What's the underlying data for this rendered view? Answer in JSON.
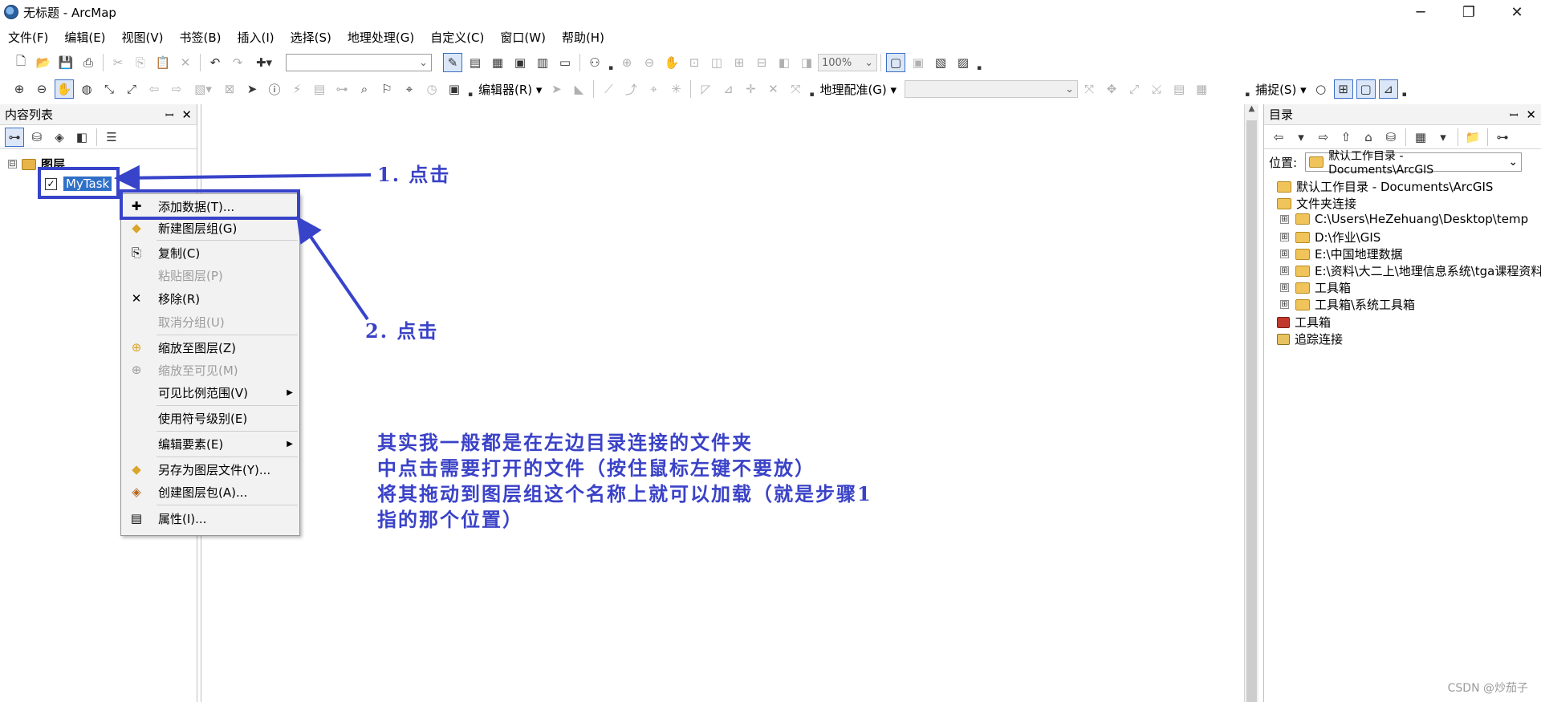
{
  "window": {
    "title": "无标题 - ArcMap",
    "minimize": "─",
    "maximize": "❐",
    "close": "✕"
  },
  "menubar": [
    "文件(F)",
    "编辑(E)",
    "视图(V)",
    "书签(B)",
    "插入(I)",
    "选择(S)",
    "地理处理(G)",
    "自定义(C)",
    "窗口(W)",
    "帮助(H)"
  ],
  "toolbar1": {
    "scale_combo": "",
    "zoom_combo": "100%"
  },
  "toolbar2": {
    "editor_label": "编辑器(R) ▾",
    "georef_label": "地理配准(G) ▾",
    "georef_combo": "",
    "snapping_label": "捕捉(S) ▾"
  },
  "toc": {
    "title": "内容列表",
    "pin": "ꟷ",
    "close": "✕",
    "root_expander": "⊟",
    "root_label": "图层",
    "layer_check": "✓",
    "layer_name": "MyTask"
  },
  "context_menu": {
    "items": [
      {
        "label": "添加数据(T)...",
        "icon": "✚",
        "disabled": false
      },
      {
        "label": "新建图层组(G)",
        "icon": "◆",
        "disabled": false
      },
      {
        "label": "复制(C)",
        "icon": "⎘",
        "disabled": false
      },
      {
        "label": "粘贴图层(P)",
        "icon": "",
        "disabled": true
      },
      {
        "label": "移除(R)",
        "icon": "✕",
        "disabled": false
      },
      {
        "label": "取消分组(U)",
        "icon": "",
        "disabled": true
      },
      {
        "label": "缩放至图层(Z)",
        "icon": "⊕",
        "disabled": false
      },
      {
        "label": "缩放至可见(M)",
        "icon": "⊕",
        "disabled": true
      },
      {
        "label": "可见比例范围(V)",
        "icon": "",
        "disabled": false,
        "submenu": "▶"
      },
      {
        "label": "使用符号级别(E)",
        "icon": "",
        "disabled": false
      },
      {
        "label": "编辑要素(E)",
        "icon": "",
        "disabled": false,
        "submenu": "▶"
      },
      {
        "label": "另存为图层文件(Y)...",
        "icon": "◆",
        "disabled": false
      },
      {
        "label": "创建图层包(A)...",
        "icon": "◈",
        "disabled": false
      },
      {
        "label": "属性(I)...",
        "icon": "▤",
        "disabled": false
      }
    ]
  },
  "catalog": {
    "title": "目录",
    "pin": "ꟷ",
    "close": "✕",
    "location_label": "位置:",
    "location_value": "默认工作目录 - Documents\\ArcGIS",
    "tree": [
      {
        "label": "默认工作目录 - Documents\\ArcGIS"
      },
      {
        "label": "文件夹连接"
      },
      {
        "label": "C:\\Users\\HeZehuang\\Desktop\\temp",
        "expander": "⊞"
      },
      {
        "label": "D:\\作业\\GIS",
        "expander": "⊞"
      },
      {
        "label": "E:\\中国地理数据",
        "expander": "⊞"
      },
      {
        "label": "E:\\资料\\大二上\\地理信息系统\\tga课程资料",
        "expander": "⊞"
      },
      {
        "label": "工具箱",
        "expander": "⊞"
      },
      {
        "label": "工具箱\\系统工具箱",
        "expander": "⊞"
      },
      {
        "label": "工具箱"
      },
      {
        "label": "追踪连接"
      }
    ]
  },
  "annotations": {
    "step1": "1. 点击",
    "step2": "2. 点击",
    "paragraph": [
      "其实我一般都是在左边目录连接的文件夹",
      "中点击需要打开的文件（按住鼠标左键不要放）",
      "将其拖动到图层组这个名称上就可以加载（就是步骤1",
      "指的那个位置）"
    ],
    "color": "#3743c9"
  },
  "watermark": "CSDN @炒茄子"
}
